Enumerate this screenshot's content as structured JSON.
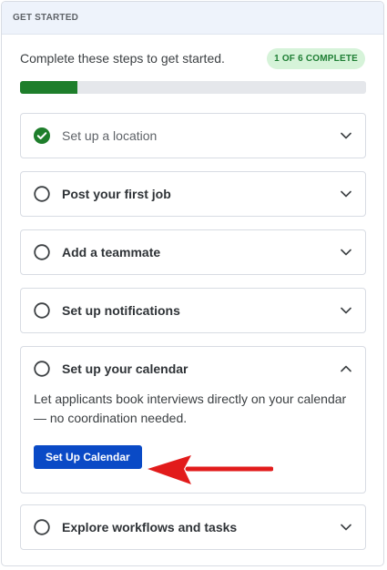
{
  "panel": {
    "header_title": "GET STARTED",
    "intro_text": "Complete these steps to get started.",
    "badge_text": "1 OF 6 COMPLETE",
    "progress_fraction": 0.1667,
    "accent_color": "#1e7e2b",
    "primary_button_color": "#0a4ac6",
    "annotation_arrow_color": "#e21b1b"
  },
  "steps": [
    {
      "title": "Set up a location",
      "status": "complete",
      "status_icon": "check-circle-icon",
      "expanded": false,
      "chevron_icon": "chevron-down-icon"
    },
    {
      "title": "Post your first job",
      "status": "incomplete",
      "status_icon": "empty-circle-icon",
      "expanded": false,
      "chevron_icon": "chevron-down-icon"
    },
    {
      "title": "Add a teammate",
      "status": "incomplete",
      "status_icon": "empty-circle-icon",
      "expanded": false,
      "chevron_icon": "chevron-down-icon"
    },
    {
      "title": "Set up notifications",
      "status": "incomplete",
      "status_icon": "empty-circle-icon",
      "expanded": false,
      "chevron_icon": "chevron-down-icon"
    },
    {
      "title": "Set up your calendar",
      "status": "incomplete",
      "status_icon": "empty-circle-icon",
      "expanded": true,
      "chevron_icon": "chevron-up-icon",
      "description": "Let applicants book interviews directly on your calendar — no coordination needed.",
      "button_label": "Set Up Calendar"
    },
    {
      "title": "Explore workflows and tasks",
      "status": "incomplete",
      "status_icon": "empty-circle-icon",
      "expanded": false,
      "chevron_icon": "chevron-down-icon"
    }
  ]
}
